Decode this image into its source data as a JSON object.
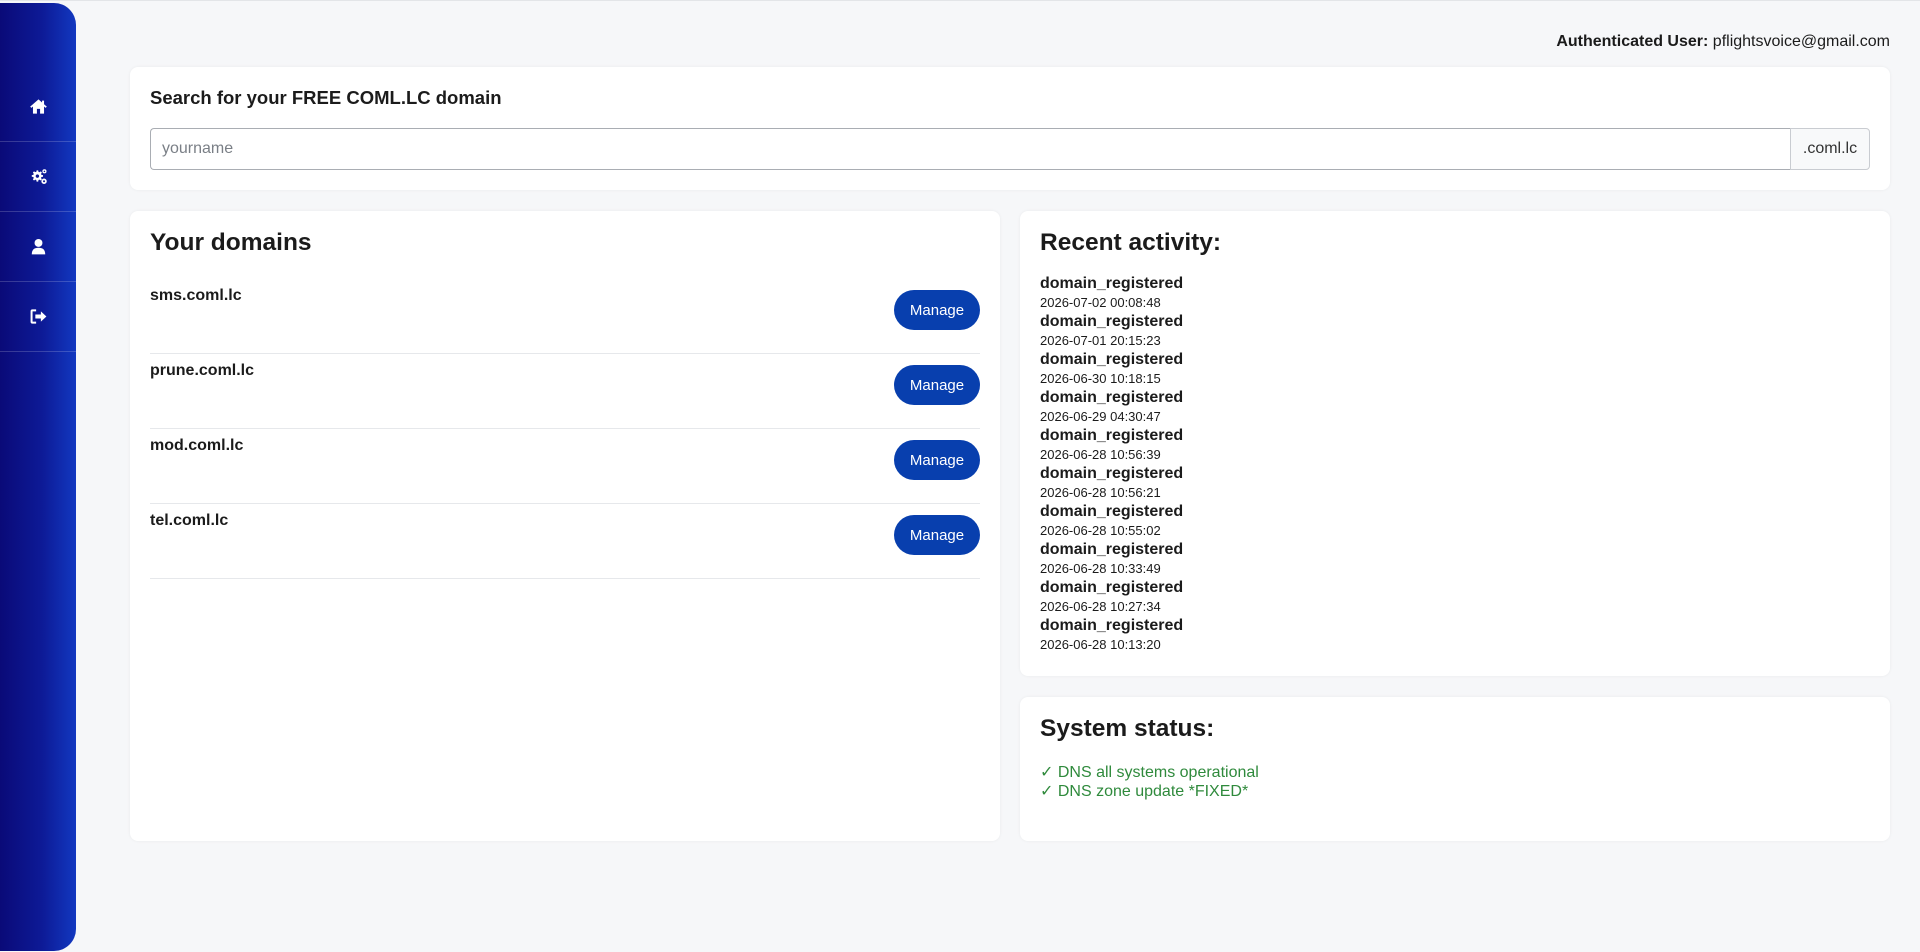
{
  "sidebar": {
    "items": [
      {
        "icon": "home-icon"
      },
      {
        "icon": "gears-icon"
      },
      {
        "icon": "user-icon"
      },
      {
        "icon": "sign-out-icon"
      }
    ]
  },
  "header": {
    "auth_label": "Authenticated User:",
    "auth_email": "pflightsvoice@gmail.com"
  },
  "search": {
    "title": "Search for your FREE COML.LC domain",
    "placeholder": "yourname",
    "value": "",
    "suffix": ".coml.lc"
  },
  "domains": {
    "title": "Your domains",
    "manage_label": "Manage",
    "items": [
      {
        "name": "sms.coml.lc"
      },
      {
        "name": "prune.coml.lc"
      },
      {
        "name": "mod.coml.lc"
      },
      {
        "name": "tel.coml.lc"
      }
    ]
  },
  "activity": {
    "title": "Recent activity:",
    "items": [
      {
        "type": "domain_registered",
        "time": "2026-07-02 00:08:48"
      },
      {
        "type": "domain_registered",
        "time": "2026-07-01 20:15:23"
      },
      {
        "type": "domain_registered",
        "time": "2026-06-30 10:18:15"
      },
      {
        "type": "domain_registered",
        "time": "2026-06-29 04:30:47"
      },
      {
        "type": "domain_registered",
        "time": "2026-06-28 10:56:39"
      },
      {
        "type": "domain_registered",
        "time": "2026-06-28 10:56:21"
      },
      {
        "type": "domain_registered",
        "time": "2026-06-28 10:55:02"
      },
      {
        "type": "domain_registered",
        "time": "2026-06-28 10:33:49"
      },
      {
        "type": "domain_registered",
        "time": "2026-06-28 10:27:34"
      },
      {
        "type": "domain_registered",
        "time": "2026-06-28 10:13:20"
      }
    ]
  },
  "status": {
    "title": "System status:",
    "items": [
      {
        "text": "✓ DNS all systems operational"
      },
      {
        "text": "✓ DNS zone update *FIXED*"
      }
    ],
    "ok_color": "#2f8a3c"
  },
  "colors": {
    "sidebar": "#0d1a96",
    "button": "#083fae"
  }
}
